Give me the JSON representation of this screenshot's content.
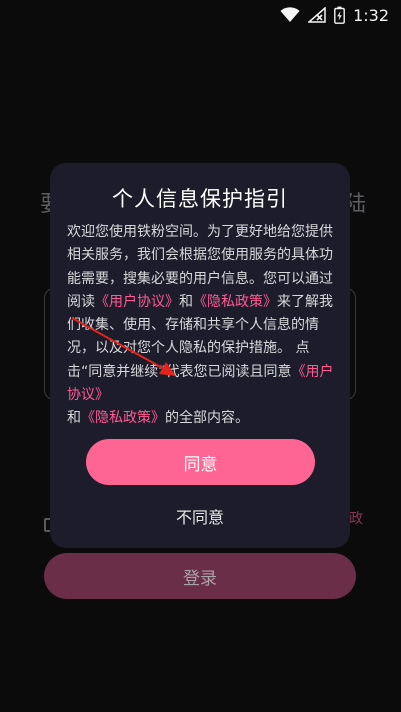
{
  "status_bar": {
    "time": "1:32",
    "icons": [
      "wifi-icon",
      "no-signal-icon",
      "battery-charging-icon"
    ]
  },
  "background": {
    "title_left_char": "要",
    "title_right_char": "陆",
    "right_link_char": "政",
    "login_label": "登录"
  },
  "dialog": {
    "title": "个人信息保护指引",
    "body": {
      "p1": "欢迎您使用铁粉空间。为了更好地给您提供相关服务，我们会根据您使用服务的具体功能需要，搜集必要的用户信息。您可以通过阅读",
      "link_user_agreement": "《用户协议》",
      "and1": "和",
      "link_privacy_policy": "《隐私政策》",
      "p2": "来了解我们收集、使用、存储和共享个人信息的情况，以及对您个人隐私的保护措施。 点击“同意并继续”代表您已阅读且同意",
      "link_user_agreement_2": "《用户协议》",
      "and2": "和",
      "link_privacy_policy_2": "《隐私政策》",
      "p3": "的全部内容。"
    },
    "agree_label": "同意",
    "disagree_label": "不同意"
  },
  "colors": {
    "accent": "#ff6592",
    "link": "#ff5a94",
    "dialog_bg": "#1d1c2a",
    "annotation": "#e0251b"
  }
}
